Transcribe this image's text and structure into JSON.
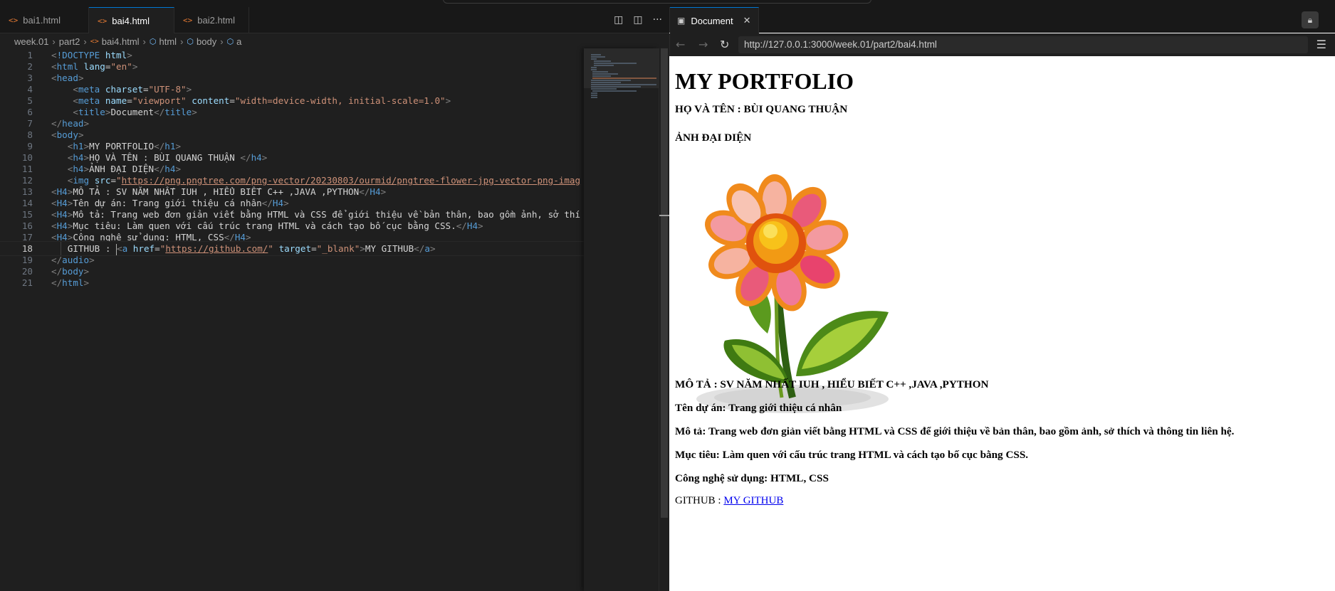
{
  "editor": {
    "tabs": [
      {
        "label": "bai1.html"
      },
      {
        "label": "bai4.html"
      },
      {
        "label": "bai2.html"
      }
    ],
    "active_tab": "bai4.html",
    "breadcrumb": [
      "week.01",
      "part2",
      "bai4.html",
      "html",
      "body",
      "a"
    ],
    "lines": [
      {
        "n": "1"
      },
      {
        "n": "2"
      },
      {
        "n": "3"
      },
      {
        "n": "4"
      },
      {
        "n": "5"
      },
      {
        "n": "6"
      },
      {
        "n": "7"
      },
      {
        "n": "8"
      },
      {
        "n": "9"
      },
      {
        "n": "10"
      },
      {
        "n": "11"
      },
      {
        "n": "12"
      },
      {
        "n": "13"
      },
      {
        "n": "14"
      },
      {
        "n": "15"
      },
      {
        "n": "16"
      },
      {
        "n": "17"
      },
      {
        "n": "18"
      },
      {
        "n": "19"
      },
      {
        "n": "20"
      },
      {
        "n": "21"
      }
    ],
    "code": {
      "doctype": "!DOCTYPE",
      "html_kw": "html",
      "html": "html",
      "lang_attr": "lang",
      "lang_val": "\"en\"",
      "head": "head",
      "meta": "meta",
      "charset_attr": "charset",
      "charset_val": "\"UTF-8\"",
      "name_attr": "name",
      "name_val": "\"viewport\"",
      "content_attr": "content",
      "content_val": "\"width=device-width, initial-scale=1.0\"",
      "title": "title",
      "title_text": "Document",
      "body": "body",
      "h1": "h1",
      "h1_text": "MY PORTFOLIO",
      "h4": "h4",
      "H4": "H4",
      "h4_name_text": "HỌ VÀ TÊN : BÙI QUANG THUẬN ",
      "h4_avatar_text": "ẢNH ĐẠI DIỆN",
      "img": "img",
      "src_attr": "src",
      "src_val": "https://png.pngtree.com/png-vector/20230803/ourmid/pngtree-flower-jpg-vector-png-imag",
      "line13_text": "MÔ TẢ : SV NĂM NHẤT IUH , HIỂU BIẾT C++ ,JAVA ,PYTHON",
      "line14_text": "Tên dự án: Trang giới thiệu cá nhân",
      "line15_text": "Mô tả: Trang web đơn giản viết bằng HTML và CSS để giới thiệu về bản thân, bao gồm ảnh, sở thí",
      "line16_text": "Mục tiêu: Làm quen với cấu trúc trang HTML và cách tạo bố cục bằng CSS.",
      "line17_text": "Công nghệ sử dụng: HTML, CSS",
      "github_prefix": "GITHUB : ",
      "a": "a",
      "href_attr": "href",
      "href_val": "https://github.com/",
      "target_attr": "target",
      "target_val": "\"_blank\"",
      "a_text": "MY GITHUB",
      "audio": "audio"
    }
  },
  "preview": {
    "tab_title": "Document",
    "url": "http://127.0.0.1:3000/week.01/part2/bai4.html",
    "h1": "MY PORTFOLIO",
    "name": "HỌ VÀ TÊN : BÙI QUANG THUẬN",
    "avatar_label": "ẢNH ĐẠI DIỆN",
    "desc1": "MÔ TẢ : SV NĂM NHẤT IUH , HIỂU BIẾT C++ ,JAVA ,PYTHON",
    "project": "Tên dự án: Trang giới thiệu cá nhân",
    "desc2": "Mô tả: Trang web đơn giản viết bằng HTML và CSS để giới thiệu về bản thân, bao gồm ảnh, sở thích và thông tin liên hệ.",
    "goal": "Mục tiêu: Làm quen với cấu trúc trang HTML và cách tạo bố cục bằng CSS.",
    "tech": "Công nghệ sử dụng: HTML, CSS",
    "github_prefix": "GITHUB : ",
    "github_link": "MY GITHUB"
  },
  "icons": {
    "file": "html-file-icon",
    "split": "split-editor-icon",
    "more": "more-actions-icon",
    "back": "arrow-left-icon",
    "forward": "arrow-right-icon",
    "reload": "reload-icon",
    "lock": "lock-icon",
    "menu": "menu-icon"
  }
}
